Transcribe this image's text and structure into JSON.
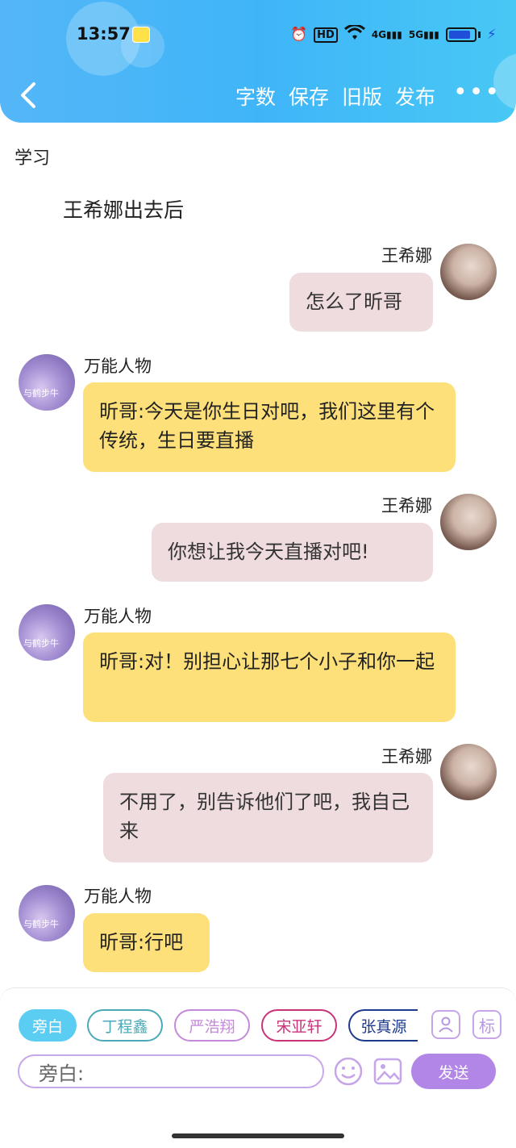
{
  "status_bar": {
    "time": "13:57",
    "icons": [
      "alarm-icon",
      "hd-icon",
      "wifi-icon",
      "4g-signal-icon",
      "5g-signal-icon",
      "battery-icon"
    ],
    "hd_label": "HD",
    "net1_label": "4G",
    "net2_label": "5G"
  },
  "header": {
    "actions": [
      "字数",
      "保存",
      "旧版",
      "发布"
    ],
    "more_label": "•••"
  },
  "story": {
    "section_title": "学习",
    "narration": "王希娜出去后"
  },
  "messages": [
    {
      "side": "right",
      "name": "王希娜",
      "text": "怎么了昕哥"
    },
    {
      "side": "left",
      "name": "万能人物",
      "text": "昕哥:今天是你生日对吧，我们这里有个传统，生日要直播"
    },
    {
      "side": "right",
      "name": "王希娜",
      "text": "你想让我今天直播对吧!"
    },
    {
      "side": "left",
      "name": "万能人物",
      "text": "昕哥:对！别担心让那七个小子和你一起"
    },
    {
      "side": "right",
      "name": "王希娜",
      "text": "不用了，别告诉他们了吧，我自己来"
    },
    {
      "side": "left",
      "name": "万能人物",
      "text": "昕哥:行吧"
    }
  ],
  "roles": [
    {
      "label": "旁白",
      "color": "#5bcdf3",
      "active": true
    },
    {
      "label": "丁程鑫",
      "color": "#4ba9b8",
      "active": false
    },
    {
      "label": "严浩翔",
      "color": "#c48ad9",
      "active": false
    },
    {
      "label": "宋亚轩",
      "color": "#c8347a",
      "active": false
    },
    {
      "label": "张真源",
      "color": "#1e3a8a",
      "active": false
    }
  ],
  "tools": {
    "tag_label": "标"
  },
  "composer": {
    "input_value": "旁白:",
    "send_label": "发送"
  }
}
